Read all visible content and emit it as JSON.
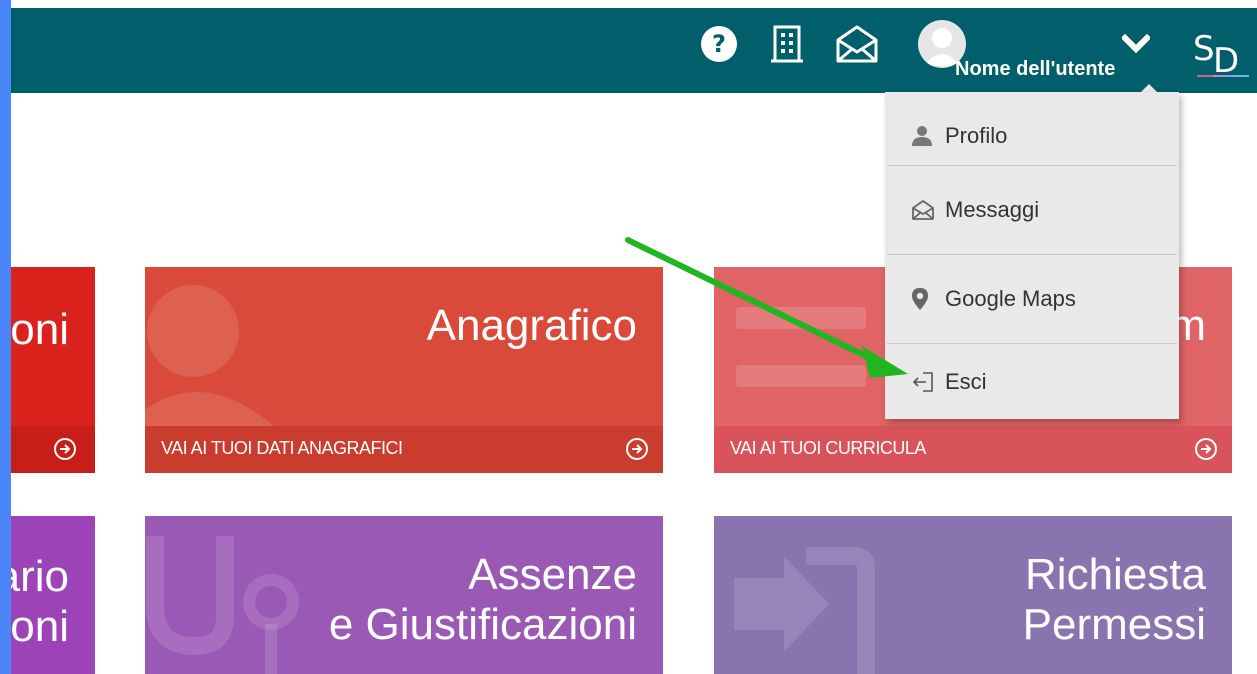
{
  "header": {
    "user_name": "Nome dell'utente",
    "icons": [
      "help-icon",
      "building-icon",
      "envelope-open-icon",
      "avatar",
      "chevron-down-icon",
      "sd-logo"
    ]
  },
  "dropdown": {
    "items": [
      {
        "label": "Profilo",
        "icon": "user-icon"
      },
      {
        "label": "Messaggi",
        "icon": "envelope-open-icon"
      },
      {
        "label": "Google Maps",
        "icon": "map-marker-icon"
      },
      {
        "label": "Esci",
        "icon": "sign-out-icon"
      }
    ]
  },
  "tiles": {
    "row1": [
      {
        "title": "oni",
        "footer": "",
        "color": "#d9221c",
        "footer_color": "#c81e18"
      },
      {
        "title": "Anagrafico",
        "footer": "VAI AI TUOI DATI ANAGRAFICI",
        "color": "#d94a3a",
        "footer_color": "#c93c2e"
      },
      {
        "title": "m",
        "footer": "VAI AI TUOI CURRICULA",
        "color": "#e06466",
        "footer_color": "#d9545a"
      }
    ],
    "row2": [
      {
        "title_line1": "ario",
        "title_line2": "oni",
        "color": "#9d43b8"
      },
      {
        "title_line1": "Assenze",
        "title_line2": "e Giustificazioni",
        "color": "#9b59b6"
      },
      {
        "title_line1": "Richiesta",
        "title_line2": "Permessi",
        "color": "#8a74b0"
      }
    ]
  },
  "colors": {
    "topbar": "#015e6b",
    "annotation_arrow": "#22b522"
  }
}
